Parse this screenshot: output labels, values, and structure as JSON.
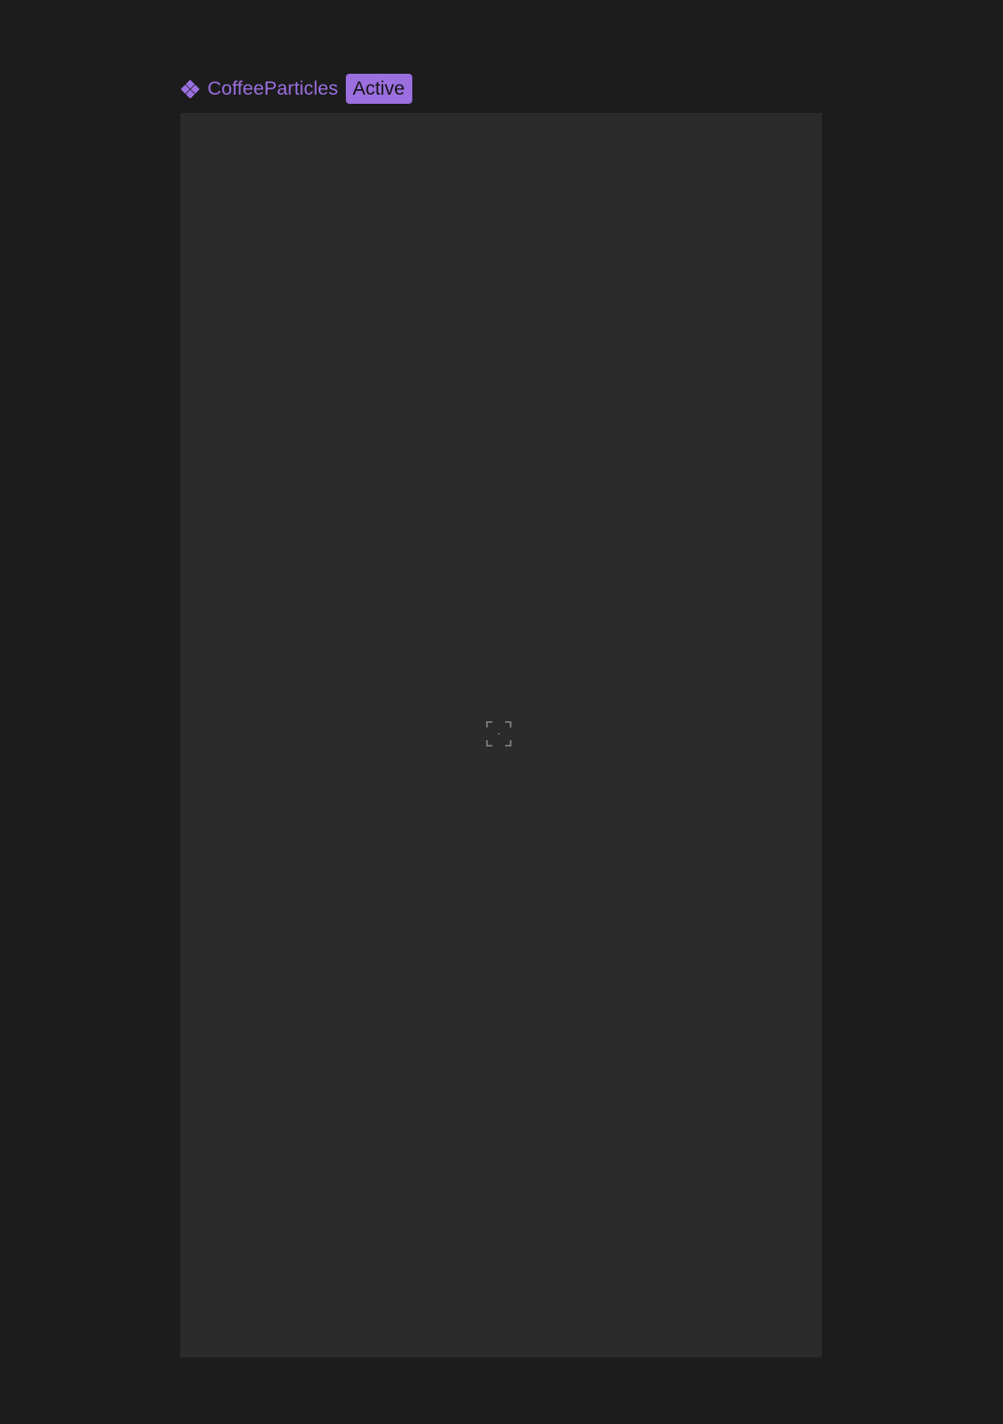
{
  "header": {
    "component_icon": "component-diamond-icon",
    "component_name": "CoffeeParticles",
    "status_badge": "Active"
  },
  "canvas": {
    "center_icon": "focus-frame-icon"
  },
  "colors": {
    "page_background": "#1c1c1c",
    "canvas_background": "#2b2b2b",
    "accent": "#9b6fe0",
    "badge_text": "#141414",
    "icon_stroke": "#8a8a8a"
  }
}
